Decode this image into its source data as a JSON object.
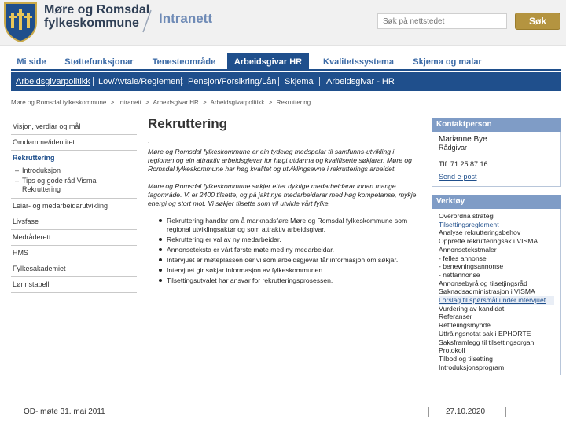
{
  "header": {
    "org_line1": "Møre og Romsdal",
    "org_line2": "fylkeskommune",
    "section": "Intranett",
    "search_placeholder": "Søk på nettstedet",
    "search_button": "Søk",
    "brand_color": "#b49440"
  },
  "main_nav": {
    "tabs": [
      {
        "label": "Mi side",
        "active": false
      },
      {
        "label": "Støttefunksjonar",
        "active": false
      },
      {
        "label": "Tenesteområde",
        "active": false
      },
      {
        "label": "Arbeidsgivar HR",
        "active": true
      },
      {
        "label": "Kvalitetssystema",
        "active": false
      },
      {
        "label": "Skjema og malar",
        "active": false
      }
    ],
    "accent_color": "#1f4f8c"
  },
  "sub_nav": {
    "items": [
      {
        "label": "Arbeidsgivarpolitikk",
        "active": true
      },
      {
        "label": "Lov/Avtale/Reglement",
        "active": false
      },
      {
        "label": "Pensjon/Forsikring/Lån",
        "active": false
      },
      {
        "label": "Skjema",
        "active": false
      },
      {
        "label": "Arbeidsgivar - HR",
        "active": false
      }
    ]
  },
  "breadcrumb": [
    "Møre og Romsdal fylkeskommune",
    ">",
    "Intranett",
    ">",
    "Arbeidsgivar HR",
    ">",
    "Arbeidsgivarpolitikk",
    ">",
    "Rekruttering"
  ],
  "sidebar": {
    "items": [
      {
        "label": "Visjon, verdiar og mål"
      },
      {
        "label": "Omdømme/identitet"
      },
      {
        "label": "Rekruttering"
      },
      {
        "label": "Leiar- og medarbeidarutvikling"
      },
      {
        "label": "Livsfase"
      },
      {
        "label": "Medråderett"
      },
      {
        "label": "HMS"
      },
      {
        "label": "Fylkesakademiet"
      },
      {
        "label": "Lønnstabell"
      }
    ],
    "subitems": [
      {
        "label": "Introduksjon"
      },
      {
        "label": "Tips og gode råd Visma Rekruttering"
      }
    ]
  },
  "content": {
    "title": "Rekruttering",
    "dot": ".",
    "para1": "Møre og Romsdal fylkeskommune er ein tydeleg medspelar til samfunns-utvikling i regionen og ein attraktiv arbeidsgjevar for høgt utdanna og kvalifiserte søkjarar. Møre og Romsdal fylkeskommune har høg kvalitet og utviklingsevne i rekrutterings arbeidet.",
    "para2": "Møre og Romsdal fylkeskommune søkjer etter dyktige medarbeidarar innan mange fagområde. Vi er 2400 tilsette, og på jakt nye medarbeidarar med høg kompetanse, mykje energi og stort mot. Vi søkjer tilsette som vil utvikle vårt fylke.",
    "bullets": [
      "Rekruttering handlar om å marknadsføre Møre og Romsdal fylkeskommune som regional utviklingsaktør og som attraktiv arbeidsgivar.",
      "Rekruttering er val av ny medarbeidar.",
      "Annonseteksta er vårt første møte med ny medarbeidar.",
      "Intervjuet er møteplassen der vi som arbeidsgjevar får informasjon om søkjar.",
      "Intervjuet gir søkjar informasjon av fylkeskommunen.",
      "Tilsettingsutvalet har ansvar for rekrutteringsprosessen."
    ]
  },
  "contact_box": {
    "title": "Kontaktperson",
    "name": "Marianne Bye",
    "role": "Rådgivar",
    "phone": "Tlf. 71 25 87 16",
    "mail": "Send e-post"
  },
  "tools_box": {
    "title": "Verktøy",
    "items": [
      {
        "label": "Overordna strategi",
        "link": false,
        "highlight": false
      },
      {
        "label": "Tilsettingsreglement",
        "link": true,
        "highlight": false
      },
      {
        "label": "Analyse rekrutteringsbehov",
        "link": false,
        "highlight": false
      },
      {
        "label": "Opprette rekrutteringsak i VISMA",
        "link": false,
        "highlight": false
      },
      {
        "label": "Annonsetekstmaler",
        "link": false,
        "highlight": false
      },
      {
        "label": "- felles annonse",
        "link": false,
        "highlight": false
      },
      {
        "label": "- benevningsannonse",
        "link": false,
        "highlight": false
      },
      {
        "label": "- nettannonse",
        "link": false,
        "highlight": false
      },
      {
        "label": "Annonsebyrå og tilsetjingsråd",
        "link": false,
        "highlight": false
      },
      {
        "label": "Søknadsadministrasjon i VISMA",
        "link": false,
        "highlight": false
      },
      {
        "label": "Lorslag til spørsmål under intervjuet",
        "link": true,
        "highlight": true
      },
      {
        "label": "Vurdering av kandidat",
        "link": false,
        "highlight": false
      },
      {
        "label": "Referanser",
        "link": false,
        "highlight": false
      },
      {
        "label": "Rettleiingsmynde",
        "link": false,
        "highlight": false
      },
      {
        "label": "Utfråingsnotat sak i EPHORTE",
        "link": false,
        "highlight": false
      },
      {
        "label": "Saksframlegg til tilsettingsorgan",
        "link": false,
        "highlight": false
      },
      {
        "label": "Protokoll",
        "link": false,
        "highlight": false
      },
      {
        "label": "Tilbod og tilsetting",
        "link": false,
        "highlight": false
      },
      {
        "label": "Introduksjonsprogram",
        "link": false,
        "highlight": false
      }
    ]
  },
  "footer": {
    "left": "OD- møte 31. mai 2011",
    "date": "27.10.2020"
  }
}
